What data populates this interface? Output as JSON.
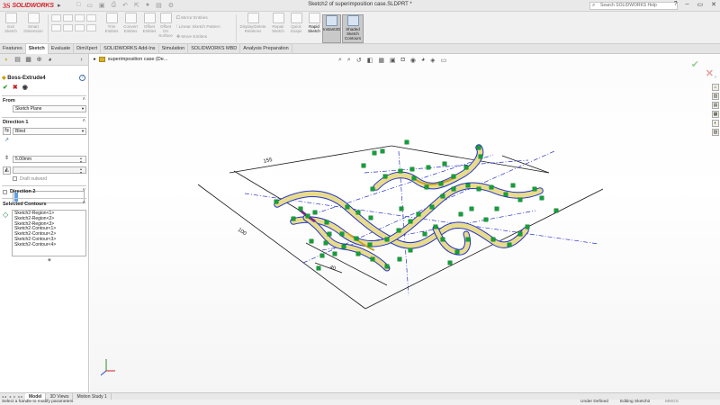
{
  "app": {
    "logo_ds": "3S",
    "logo_text": "SOLIDWORKS",
    "doc_title": "Sketch2 of superimposition case.SLDPRT *",
    "help_search_placeholder": "Search SOLIDWORKS Help"
  },
  "ribbon": {
    "exit_sketch": "Exit\nSketch",
    "smart_dimension": "Smart\nDimension",
    "trim_entities": "Trim\nEntities",
    "convert_entities": "Convert\nEntities",
    "offset_entities": "Offset\nEntities",
    "offset_on_surface": "Offset\nOn\nSurface",
    "mirror_entities": "Mirror Entities",
    "linear_sketch_pattern": "Linear Sketch Pattern",
    "move_entities": "Move Entities",
    "display_delete_relations": "Display/Delete\nRelations",
    "repair_sketch": "Repair\nSketch",
    "quick_snaps": "Quick\nSnaps",
    "rapid_sketch": "Rapid\nSketch",
    "instant2d": "Instant2D",
    "shaded_sketch_contours": "Shaded\nSketch\nContours"
  },
  "tabs": [
    "Features",
    "Sketch",
    "Evaluate",
    "DimXpert",
    "SOLIDWORKS Add-Ins",
    "Simulation",
    "SOLIDWORKS MBD",
    "Analysis Preparation"
  ],
  "active_tab": "Sketch",
  "panel": {
    "feature_title": "Boss-Extrude4",
    "from_label": "From",
    "from_value": "Sketch Plane",
    "direction1_label": "Direction 1",
    "end_condition": "Blind",
    "depth_value": "5.00mm",
    "draft_outward": "Draft outward",
    "direction2_label": "Direction 2",
    "selected_contours_label": "Selected Contours",
    "contours": [
      "Sketch2-Region<1>",
      "Sketch2-Region<2>",
      "Sketch2-Region<3>",
      "Sketch2-Contour<1>",
      "Sketch2-Contour<2>",
      "Sketch2-Contour<3>",
      "Sketch2-Contour<4>"
    ]
  },
  "viewport": {
    "tree_label": "superimposition case (De...",
    "dim_label_1": "155",
    "dim_label_2": "100",
    "dim_label_3": "40"
  },
  "bottom_tabs": [
    "Model",
    "3D Views",
    "Motion Study 1"
  ],
  "active_bottom_tab": "Model",
  "status": {
    "message": "Select a handle to modify parameters",
    "sketch_state": "Under Defined",
    "editing": "Editing Sketch2",
    "units": "MMGS"
  },
  "colors": {
    "brand_red": "#d6222a",
    "extrude_yellow": "#e8dc8c",
    "sketch_blue": "#2233cc",
    "relation_green": "#12a03a",
    "dimension_black": "#1a1a1a"
  }
}
